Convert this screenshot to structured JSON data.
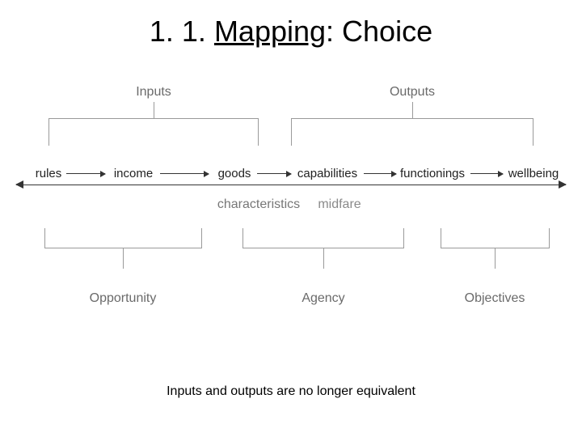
{
  "title": {
    "prefix": "1. 1. ",
    "underlined": "Mapping",
    "suffix": ": Choice"
  },
  "top_groups": {
    "inputs": "Inputs",
    "outputs": "Outputs"
  },
  "chain": {
    "n1": "rules",
    "n2": "income",
    "n3": "goods",
    "n4": "capabilities",
    "n5": "functionings",
    "n6": "wellbeing"
  },
  "mid_labels": {
    "characteristics": "characteristics",
    "midfare": "midfare"
  },
  "bottom_groups": {
    "opportunity": "Opportunity",
    "agency": "Agency",
    "objectives": "Objectives"
  },
  "caption": "Inputs and outputs are no longer equivalent"
}
